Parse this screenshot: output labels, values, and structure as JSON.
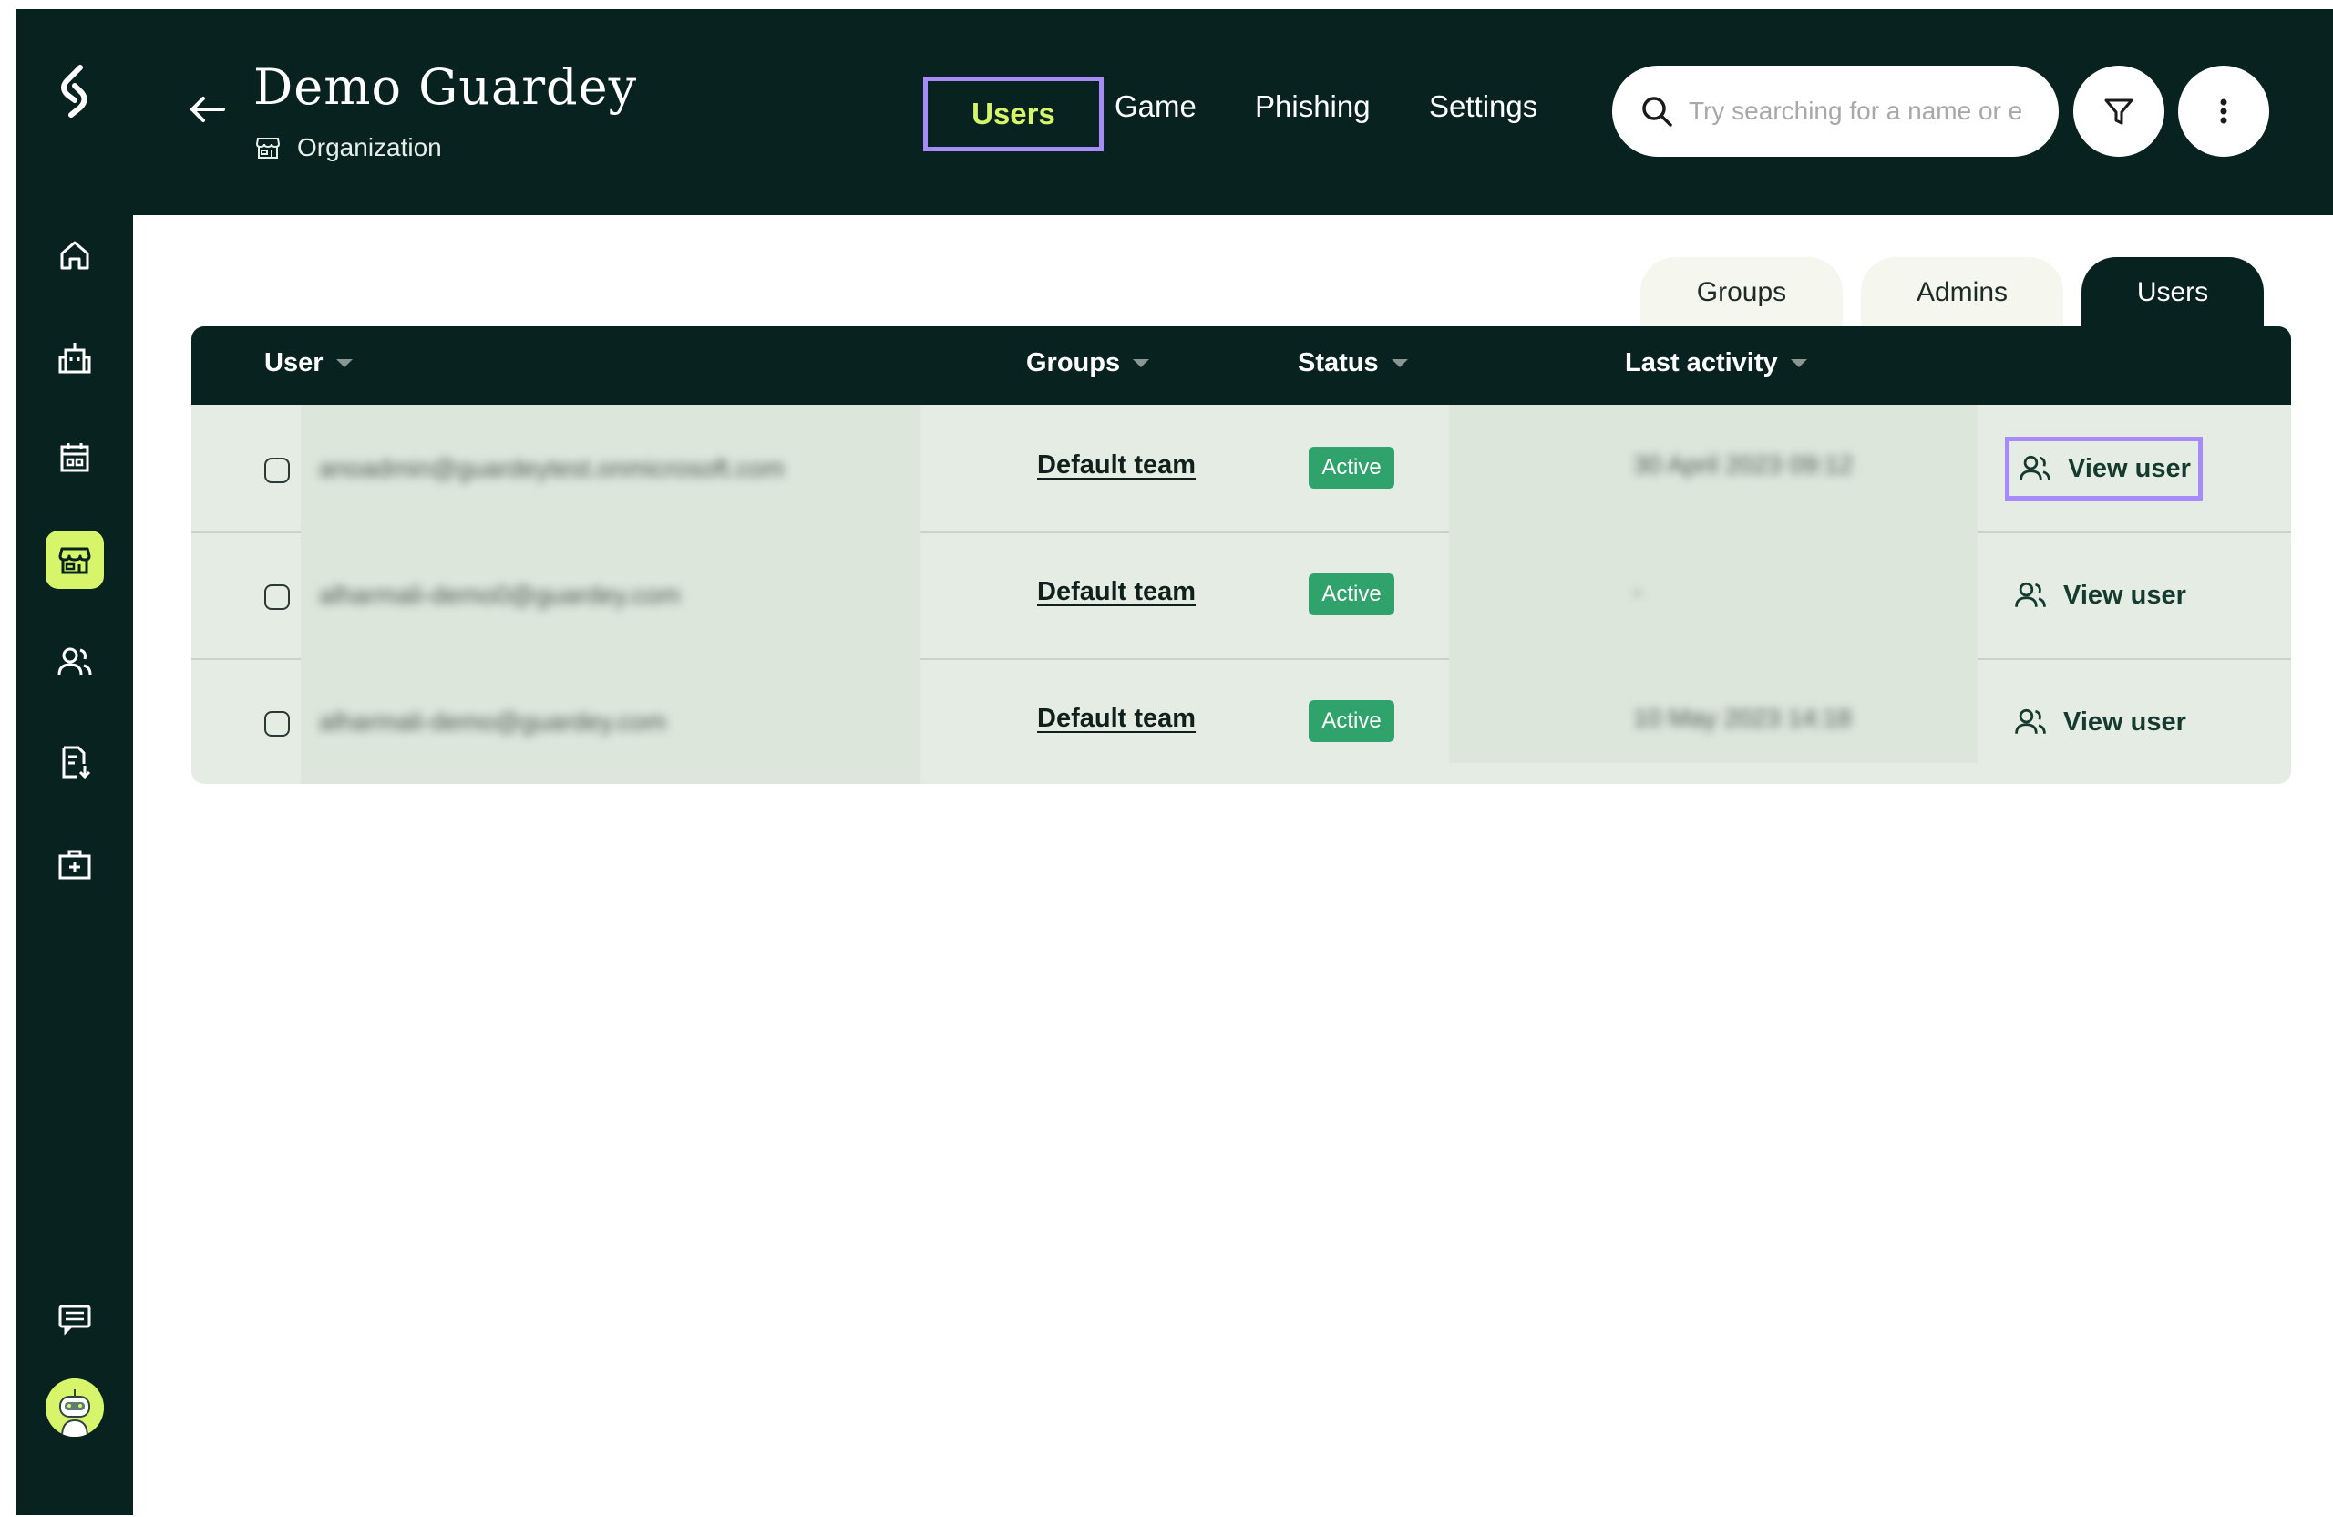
{
  "header": {
    "title": "Demo Guardey",
    "subtitle": "Organization",
    "nav_tabs": [
      {
        "label": "Users",
        "active": true
      },
      {
        "label": "Game",
        "active": false
      },
      {
        "label": "Phishing",
        "active": false
      },
      {
        "label": "Settings",
        "active": false
      }
    ],
    "search": {
      "placeholder": "Try searching for a name or e"
    }
  },
  "sidebar": {
    "items": [
      {
        "icon": "home-icon",
        "active": false
      },
      {
        "icon": "building-icon",
        "active": false
      },
      {
        "icon": "calendar-building-icon",
        "active": false
      },
      {
        "icon": "storefront-icon",
        "active": true
      },
      {
        "icon": "users-icon",
        "active": false
      },
      {
        "icon": "report-download-icon",
        "active": false
      },
      {
        "icon": "first-aid-kit-icon",
        "active": false
      }
    ],
    "bottom": [
      {
        "icon": "chat-icon"
      },
      {
        "icon": "avatar"
      }
    ]
  },
  "segment_tabs": [
    {
      "label": "Groups",
      "active": false
    },
    {
      "label": "Admins",
      "active": false
    },
    {
      "label": "Users",
      "active": true
    }
  ],
  "table": {
    "columns": [
      "User",
      "Groups",
      "Status",
      "Last activity"
    ],
    "rows": [
      {
        "user": "anoadmin@guardeytest.onmicrosoft.com",
        "group": "Default team",
        "status": "Active",
        "last_activity": "30 April 2023 09:12",
        "action": "View user"
      },
      {
        "user": "alharmali-demo0@guardey.com",
        "group": "Default team",
        "status": "Active",
        "last_activity": "-",
        "action": "View user"
      },
      {
        "user": "alharmali-demo@guardey.com",
        "group": "Default team",
        "status": "Active",
        "last_activity": "10 May 2023 14:18",
        "action": "View user"
      }
    ]
  },
  "colors": {
    "dark": "#082220",
    "accent": "#d6f56a",
    "highlight": "#a78bfa",
    "badge": "#2fa36b",
    "row_bg": "#e4ece3"
  }
}
